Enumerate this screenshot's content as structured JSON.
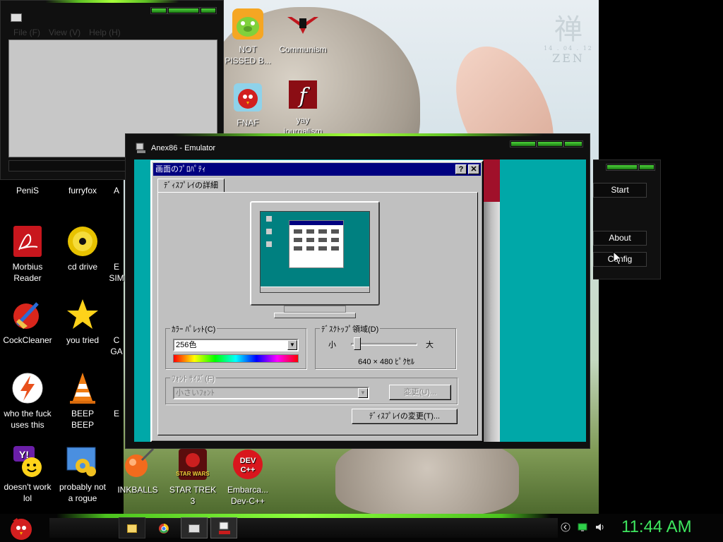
{
  "desktop": {
    "icons": [
      {
        "label": "NOT\nPISSED B...",
        "icon": "pig-icon"
      },
      {
        "label": "Communism",
        "icon": "eagle-icon"
      },
      {
        "label": "FNAF",
        "icon": "red-bird-icon"
      },
      {
        "label": "yay\njournalism",
        "icon": "flash-icon"
      },
      {
        "label": "PeniS",
        "icon": "app-icon"
      },
      {
        "label": "furryfox",
        "icon": "firefox-icon"
      },
      {
        "label": "A",
        "icon": "app-icon"
      },
      {
        "label": "Morbius\nReader",
        "icon": "pdf-reader-icon"
      },
      {
        "label": "cd drive",
        "icon": "cd-icon"
      },
      {
        "label": "E\nSIM",
        "icon": "app-icon"
      },
      {
        "label": "CockCleaner",
        "icon": "broom-icon"
      },
      {
        "label": "you tried",
        "icon": "star-icon"
      },
      {
        "label": "C\nGA",
        "icon": "app-icon"
      },
      {
        "label": "who the fuck\nuses this",
        "icon": "lightning-icon"
      },
      {
        "label": "BEEP\nBEEP",
        "icon": "traffic-cone-icon"
      },
      {
        "label": "E",
        "icon": "app-icon"
      },
      {
        "label": "doesn't work\nlol",
        "icon": "yahoo-messenger-icon"
      },
      {
        "label": "probably not\na rogue",
        "icon": "gears-icon"
      },
      {
        "label": "INKBALLS",
        "icon": "inkball-icon"
      },
      {
        "label": "STAR TREK\n3",
        "icon": "star-wars-icon"
      },
      {
        "label": "Embarca...\nDev-C++",
        "icon": "devcpp-icon"
      }
    ]
  },
  "wallpaper": {
    "date": "14 . 04 . 12",
    "word": "ZEN"
  },
  "explorer": {
    "menu": [
      "File (F)",
      "View (V)",
      "Help (H)"
    ]
  },
  "startpanel": {
    "buttons": [
      "Start",
      "About",
      "Config"
    ]
  },
  "emulator": {
    "title": "Anex86 - Emulator",
    "dialog": {
      "title": "画面のﾌﾟﾛﾊﾟﾃｨ",
      "help_btn": "?",
      "close_btn": "✕",
      "tab": "ﾃﾞｨｽﾌﾟﾚｲの詳細",
      "color_palette": {
        "caption": "ｶﾗｰ ﾊﾟﾚｯﾄ(C)",
        "value": "256色"
      },
      "desktop_area": {
        "caption": "ﾃﾞｽｸﾄｯﾌﾟ領域(D)",
        "min": "小",
        "max": "大",
        "value": "640 × 480 ﾋﾟｸｾﾙ"
      },
      "font_size": {
        "caption": "ﾌｫﾝﾄ ｻｲｽﾞ(F)",
        "value": "小さいﾌｫﾝﾄ",
        "change_btn": "変更(U)..."
      },
      "change_display_btn": "ﾃﾞｨｽﾌﾟﾚｲの変更(T)..."
    }
  },
  "taskbar": {
    "clock": "11:44 AM"
  },
  "colors": {
    "accent": "#3ee55e",
    "win95_title": "#000080",
    "emu_bg": "#00a8a8"
  }
}
